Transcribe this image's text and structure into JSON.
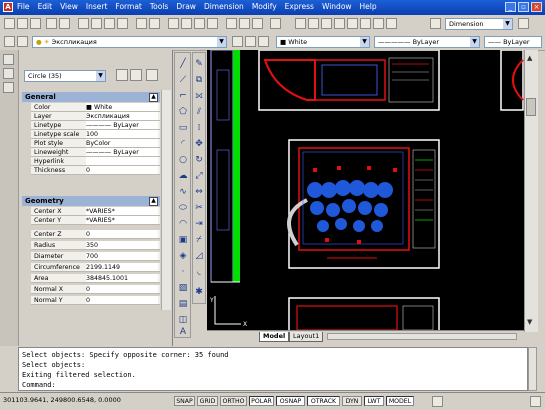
{
  "menus": [
    "File",
    "Edit",
    "View",
    "Insert",
    "Format",
    "Tools",
    "Draw",
    "Dimension",
    "Modify",
    "Express",
    "Window",
    "Help"
  ],
  "toolbar": {
    "layer_value": "Экспликация",
    "color_value": "White",
    "linetype_value": "ByLayer",
    "lineweight_value": "ByLayer",
    "dimstyle_value": "Dimension"
  },
  "properties": {
    "selection": "Circle (35)",
    "general_title": "General",
    "general": [
      {
        "k": "Color",
        "v": "White"
      },
      {
        "k": "Layer",
        "v": "Экспликация"
      },
      {
        "k": "Linetype",
        "v": "———— ByLayer"
      },
      {
        "k": "Linetype scale",
        "v": "100"
      },
      {
        "k": "Plot style",
        "v": "ByColor"
      },
      {
        "k": "Lineweight",
        "v": "———— ByLayer"
      },
      {
        "k": "Hyperlink",
        "v": ""
      },
      {
        "k": "Thickness",
        "v": "0"
      }
    ],
    "geometry_title": "Geometry",
    "geometry": [
      {
        "k": "Center X",
        "v": "*VARIES*"
      },
      {
        "k": "Center Y",
        "v": "*VARIES*"
      },
      {
        "k": "Center Z",
        "v": "0"
      },
      {
        "k": "Radius",
        "v": "350"
      },
      {
        "k": "Diameter",
        "v": "700"
      },
      {
        "k": "Circumference",
        "v": "2199.1149"
      },
      {
        "k": "Area",
        "v": "384845.1001"
      },
      {
        "k": "Normal X",
        "v": "0"
      },
      {
        "k": "Normal Y",
        "v": "0"
      }
    ]
  },
  "tabs": [
    "Model",
    "Layout1"
  ],
  "command_lines": [
    "Select objects: Specify opposite corner: 35 found",
    "Select objects:",
    "Exiting filtered selection.",
    "Command:"
  ],
  "status": {
    "coords": "301103.9641, 249800.6548, 0.0000",
    "buttons": [
      "SNAP",
      "GRID",
      "ORTHO",
      "POLAR",
      "OSNAP",
      "OTRACK",
      "DYN",
      "LWT",
      "MODEL"
    ]
  },
  "colors": {
    "canvas": "#000000",
    "accent_green": "#00e000",
    "selection_blue": "#1f58d8",
    "drawing_red": "#e01010"
  }
}
